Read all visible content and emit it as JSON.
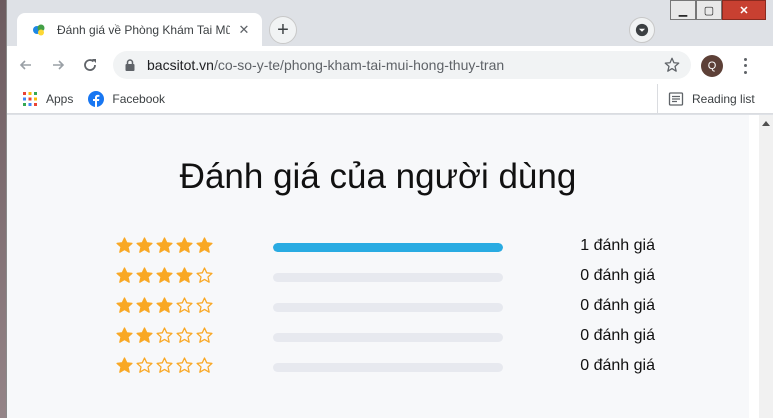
{
  "browser": {
    "tab_title": "Đánh giá về Phòng Khám Tai Mũi",
    "url_host": "bacsitot.vn",
    "url_path": "/co-so-y-te/phong-kham-tai-mui-hong-thuy-tran",
    "profile_initial": "Q",
    "bookmarks": [
      {
        "label": "Apps",
        "icon": "apps-grid-icon"
      },
      {
        "label": "Facebook",
        "icon": "facebook-icon"
      }
    ],
    "reading_list_label": "Reading list"
  },
  "page": {
    "title": "Đánh giá của người dùng",
    "ratings": [
      {
        "stars": 5,
        "count_label": "1 đánh giá",
        "fraction": 1.0
      },
      {
        "stars": 4,
        "count_label": "0 đánh giá",
        "fraction": 0.0
      },
      {
        "stars": 3,
        "count_label": "0 đánh giá",
        "fraction": 0.0
      },
      {
        "stars": 2,
        "count_label": "0 đánh giá",
        "fraction": 0.0
      },
      {
        "stars": 1,
        "count_label": "0 đánh giá",
        "fraction": 0.0
      }
    ]
  },
  "colors": {
    "star": "#f9a825",
    "bar_fill": "#29abe2",
    "bar_track": "#e7e9ef"
  }
}
